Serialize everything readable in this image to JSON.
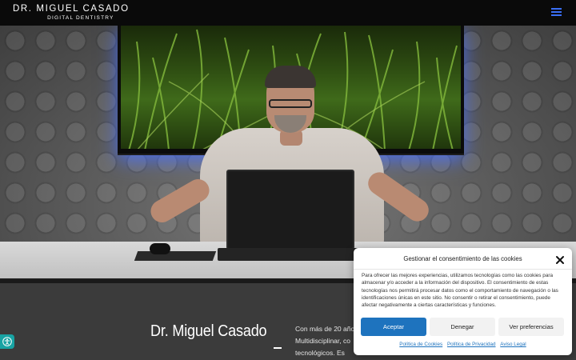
{
  "header": {
    "logo_main": "DR. MIGUEL CASADO",
    "logo_sub": "DIGITAL DENTISTRY",
    "menu_icon": "hamburger-menu-icon",
    "menu_color": "#3a6ff5"
  },
  "hero": {
    "description_icon": "hero-photo"
  },
  "content": {
    "title": "Dr. Miguel Casado",
    "text_lines": [
      "Con más de 20 año",
      "Multidisciplinar, co",
      "tecnológicos.   Es"
    ]
  },
  "accessibility": {
    "icon": "accessibility-icon",
    "color": "#18a3a3"
  },
  "cookie_modal": {
    "title": "Gestionar el consentimiento de las cookies",
    "body": "Para ofrecer las mejores experiencias, utilizamos tecnologías como las cookies para almacenar y/o acceder a la información del dispositivo. El consentimiento de estas tecnologías nos permitirá procesar datos como el comportamiento de navegación o las identificaciones únicas en este sitio. No consentir o retirar el consentimiento, puede afectar negativamente a ciertas características y funciones.",
    "accept_label": "Aceptar",
    "deny_label": "Denegar",
    "prefs_label": "Ver preferencias",
    "links": [
      "Política de Cookies",
      "Política de Privacidad",
      "Aviso Legal"
    ],
    "accent_color": "#1e73be"
  }
}
